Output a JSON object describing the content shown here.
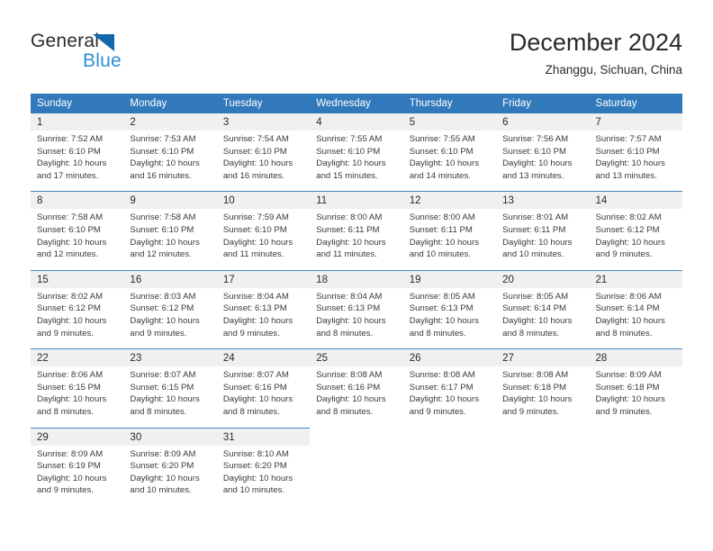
{
  "brand": {
    "name_top": "General",
    "name_bottom": "Blue",
    "triangle_color": "#1168ad",
    "blue_color": "#2d8fd5"
  },
  "header": {
    "title": "December 2024",
    "subtitle": "Zhanggu, Sichuan, China"
  },
  "theme": {
    "header_bg": "#3179ba",
    "header_text": "#ffffff",
    "daynum_bg": "#f0f0f0",
    "cell_bg": "#ffffff",
    "rule_color": "#4a86bd"
  },
  "calendar": {
    "weekday_headers": [
      "Sunday",
      "Monday",
      "Tuesday",
      "Wednesday",
      "Thursday",
      "Friday",
      "Saturday"
    ],
    "weeks": [
      [
        {
          "day": "1",
          "sunrise": "Sunrise: 7:52 AM",
          "sunset": "Sunset: 6:10 PM",
          "daylight_1": "Daylight: 10 hours",
          "daylight_2": "and 17 minutes."
        },
        {
          "day": "2",
          "sunrise": "Sunrise: 7:53 AM",
          "sunset": "Sunset: 6:10 PM",
          "daylight_1": "Daylight: 10 hours",
          "daylight_2": "and 16 minutes."
        },
        {
          "day": "3",
          "sunrise": "Sunrise: 7:54 AM",
          "sunset": "Sunset: 6:10 PM",
          "daylight_1": "Daylight: 10 hours",
          "daylight_2": "and 16 minutes."
        },
        {
          "day": "4",
          "sunrise": "Sunrise: 7:55 AM",
          "sunset": "Sunset: 6:10 PM",
          "daylight_1": "Daylight: 10 hours",
          "daylight_2": "and 15 minutes."
        },
        {
          "day": "5",
          "sunrise": "Sunrise: 7:55 AM",
          "sunset": "Sunset: 6:10 PM",
          "daylight_1": "Daylight: 10 hours",
          "daylight_2": "and 14 minutes."
        },
        {
          "day": "6",
          "sunrise": "Sunrise: 7:56 AM",
          "sunset": "Sunset: 6:10 PM",
          "daylight_1": "Daylight: 10 hours",
          "daylight_2": "and 13 minutes."
        },
        {
          "day": "7",
          "sunrise": "Sunrise: 7:57 AM",
          "sunset": "Sunset: 6:10 PM",
          "daylight_1": "Daylight: 10 hours",
          "daylight_2": "and 13 minutes."
        }
      ],
      [
        {
          "day": "8",
          "sunrise": "Sunrise: 7:58 AM",
          "sunset": "Sunset: 6:10 PM",
          "daylight_1": "Daylight: 10 hours",
          "daylight_2": "and 12 minutes."
        },
        {
          "day": "9",
          "sunrise": "Sunrise: 7:58 AM",
          "sunset": "Sunset: 6:10 PM",
          "daylight_1": "Daylight: 10 hours",
          "daylight_2": "and 12 minutes."
        },
        {
          "day": "10",
          "sunrise": "Sunrise: 7:59 AM",
          "sunset": "Sunset: 6:10 PM",
          "daylight_1": "Daylight: 10 hours",
          "daylight_2": "and 11 minutes."
        },
        {
          "day": "11",
          "sunrise": "Sunrise: 8:00 AM",
          "sunset": "Sunset: 6:11 PM",
          "daylight_1": "Daylight: 10 hours",
          "daylight_2": "and 11 minutes."
        },
        {
          "day": "12",
          "sunrise": "Sunrise: 8:00 AM",
          "sunset": "Sunset: 6:11 PM",
          "daylight_1": "Daylight: 10 hours",
          "daylight_2": "and 10 minutes."
        },
        {
          "day": "13",
          "sunrise": "Sunrise: 8:01 AM",
          "sunset": "Sunset: 6:11 PM",
          "daylight_1": "Daylight: 10 hours",
          "daylight_2": "and 10 minutes."
        },
        {
          "day": "14",
          "sunrise": "Sunrise: 8:02 AM",
          "sunset": "Sunset: 6:12 PM",
          "daylight_1": "Daylight: 10 hours",
          "daylight_2": "and 9 minutes."
        }
      ],
      [
        {
          "day": "15",
          "sunrise": "Sunrise: 8:02 AM",
          "sunset": "Sunset: 6:12 PM",
          "daylight_1": "Daylight: 10 hours",
          "daylight_2": "and 9 minutes."
        },
        {
          "day": "16",
          "sunrise": "Sunrise: 8:03 AM",
          "sunset": "Sunset: 6:12 PM",
          "daylight_1": "Daylight: 10 hours",
          "daylight_2": "and 9 minutes."
        },
        {
          "day": "17",
          "sunrise": "Sunrise: 8:04 AM",
          "sunset": "Sunset: 6:13 PM",
          "daylight_1": "Daylight: 10 hours",
          "daylight_2": "and 9 minutes."
        },
        {
          "day": "18",
          "sunrise": "Sunrise: 8:04 AM",
          "sunset": "Sunset: 6:13 PM",
          "daylight_1": "Daylight: 10 hours",
          "daylight_2": "and 8 minutes."
        },
        {
          "day": "19",
          "sunrise": "Sunrise: 8:05 AM",
          "sunset": "Sunset: 6:13 PM",
          "daylight_1": "Daylight: 10 hours",
          "daylight_2": "and 8 minutes."
        },
        {
          "day": "20",
          "sunrise": "Sunrise: 8:05 AM",
          "sunset": "Sunset: 6:14 PM",
          "daylight_1": "Daylight: 10 hours",
          "daylight_2": "and 8 minutes."
        },
        {
          "day": "21",
          "sunrise": "Sunrise: 8:06 AM",
          "sunset": "Sunset: 6:14 PM",
          "daylight_1": "Daylight: 10 hours",
          "daylight_2": "and 8 minutes."
        }
      ],
      [
        {
          "day": "22",
          "sunrise": "Sunrise: 8:06 AM",
          "sunset": "Sunset: 6:15 PM",
          "daylight_1": "Daylight: 10 hours",
          "daylight_2": "and 8 minutes."
        },
        {
          "day": "23",
          "sunrise": "Sunrise: 8:07 AM",
          "sunset": "Sunset: 6:15 PM",
          "daylight_1": "Daylight: 10 hours",
          "daylight_2": "and 8 minutes."
        },
        {
          "day": "24",
          "sunrise": "Sunrise: 8:07 AM",
          "sunset": "Sunset: 6:16 PM",
          "daylight_1": "Daylight: 10 hours",
          "daylight_2": "and 8 minutes."
        },
        {
          "day": "25",
          "sunrise": "Sunrise: 8:08 AM",
          "sunset": "Sunset: 6:16 PM",
          "daylight_1": "Daylight: 10 hours",
          "daylight_2": "and 8 minutes."
        },
        {
          "day": "26",
          "sunrise": "Sunrise: 8:08 AM",
          "sunset": "Sunset: 6:17 PM",
          "daylight_1": "Daylight: 10 hours",
          "daylight_2": "and 9 minutes."
        },
        {
          "day": "27",
          "sunrise": "Sunrise: 8:08 AM",
          "sunset": "Sunset: 6:18 PM",
          "daylight_1": "Daylight: 10 hours",
          "daylight_2": "and 9 minutes."
        },
        {
          "day": "28",
          "sunrise": "Sunrise: 8:09 AM",
          "sunset": "Sunset: 6:18 PM",
          "daylight_1": "Daylight: 10 hours",
          "daylight_2": "and 9 minutes."
        }
      ],
      [
        {
          "day": "29",
          "sunrise": "Sunrise: 8:09 AM",
          "sunset": "Sunset: 6:19 PM",
          "daylight_1": "Daylight: 10 hours",
          "daylight_2": "and 9 minutes."
        },
        {
          "day": "30",
          "sunrise": "Sunrise: 8:09 AM",
          "sunset": "Sunset: 6:20 PM",
          "daylight_1": "Daylight: 10 hours",
          "daylight_2": "and 10 minutes."
        },
        {
          "day": "31",
          "sunrise": "Sunrise: 8:10 AM",
          "sunset": "Sunset: 6:20 PM",
          "daylight_1": "Daylight: 10 hours",
          "daylight_2": "and 10 minutes."
        },
        {
          "day": "",
          "sunrise": "",
          "sunset": "",
          "daylight_1": "",
          "daylight_2": ""
        },
        {
          "day": "",
          "sunrise": "",
          "sunset": "",
          "daylight_1": "",
          "daylight_2": ""
        },
        {
          "day": "",
          "sunrise": "",
          "sunset": "",
          "daylight_1": "",
          "daylight_2": ""
        },
        {
          "day": "",
          "sunrise": "",
          "sunset": "",
          "daylight_1": "",
          "daylight_2": ""
        }
      ]
    ]
  }
}
